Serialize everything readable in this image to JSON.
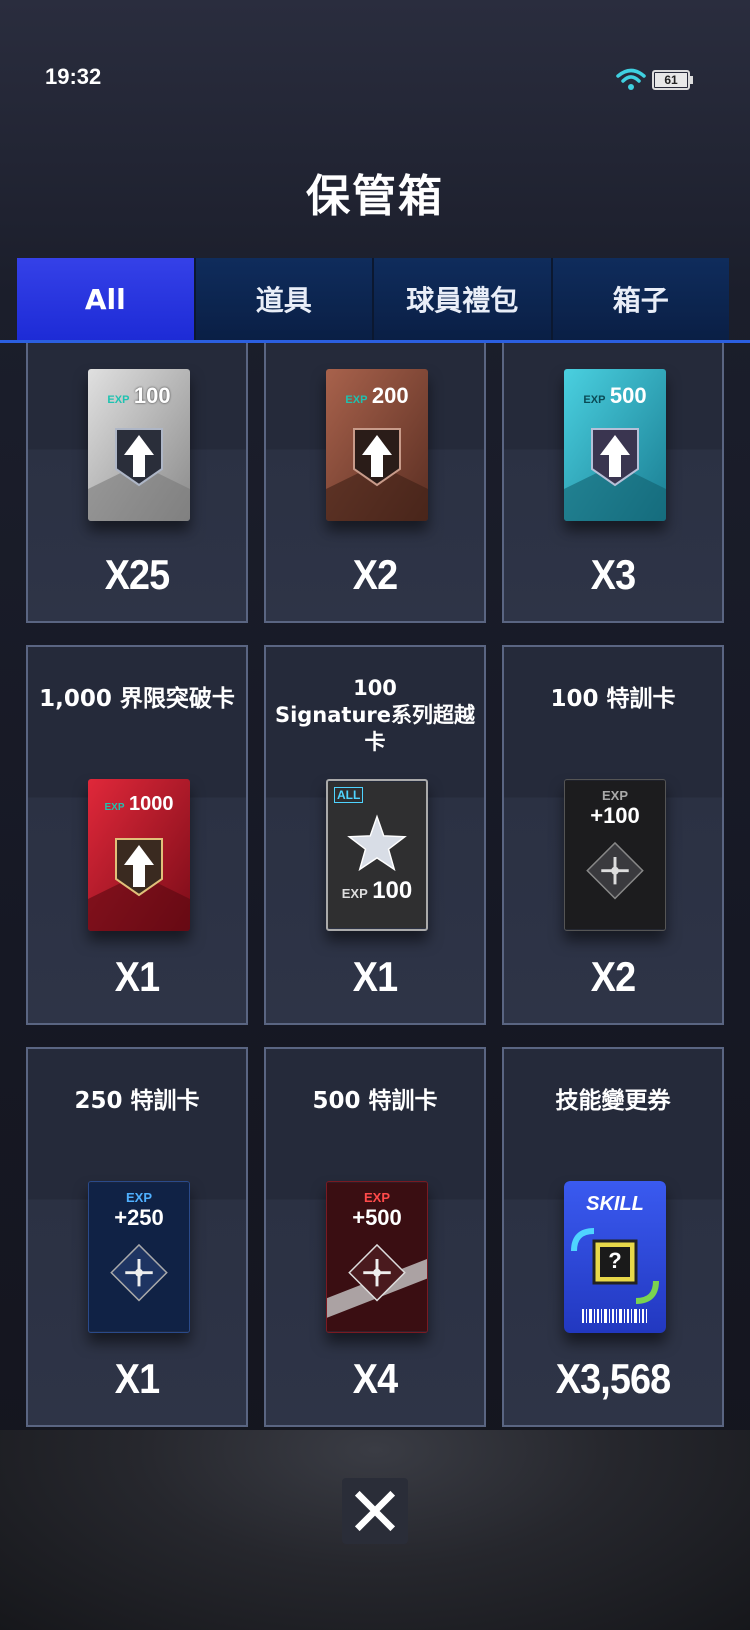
{
  "status_bar": {
    "time": "19:32",
    "battery": "61"
  },
  "title": "保管箱",
  "tabs": [
    {
      "label": "All",
      "active": true
    },
    {
      "label": "道具",
      "active": false
    },
    {
      "label": "球員禮包",
      "active": false
    },
    {
      "label": "箱子",
      "active": false
    }
  ],
  "items": [
    {
      "title": "",
      "card_label": "EXP",
      "card_value": "100",
      "quantity": "X25",
      "color": "#9a9a9a"
    },
    {
      "title": "",
      "card_label": "EXP",
      "card_value": "200",
      "quantity": "X2",
      "color": "#8a4e3c"
    },
    {
      "title": "",
      "card_label": "EXP",
      "card_value": "500",
      "quantity": "X3",
      "color": "#2aa3b8"
    },
    {
      "title": "1,000 界限突破卡",
      "card_label": "EXP",
      "card_value": "1000",
      "quantity": "X1",
      "color": "#c0182c"
    },
    {
      "title_line1": "100",
      "title_line2": "Signature系列超越卡",
      "card_badge": "ALL",
      "card_label": "EXP",
      "card_value": "100",
      "quantity": "X1",
      "color": "#2e2e2e"
    },
    {
      "title": "100 特訓卡",
      "card_label": "EXP",
      "card_value": "+100",
      "quantity": "X2",
      "color": "#1e1e1e"
    },
    {
      "title": "250 特訓卡",
      "card_label": "EXP",
      "card_value": "+250",
      "quantity": "X1",
      "color": "#13294f"
    },
    {
      "title": "500 特訓卡",
      "card_label": "EXP",
      "card_value": "+500",
      "quantity": "X4",
      "color": "#3a0f12"
    },
    {
      "title": "技能變更券",
      "card_label": "SKILL",
      "card_value": "?",
      "quantity": "X3,568",
      "color": "#2f4bd8"
    }
  ],
  "close_button": {
    "icon": "close-icon"
  }
}
